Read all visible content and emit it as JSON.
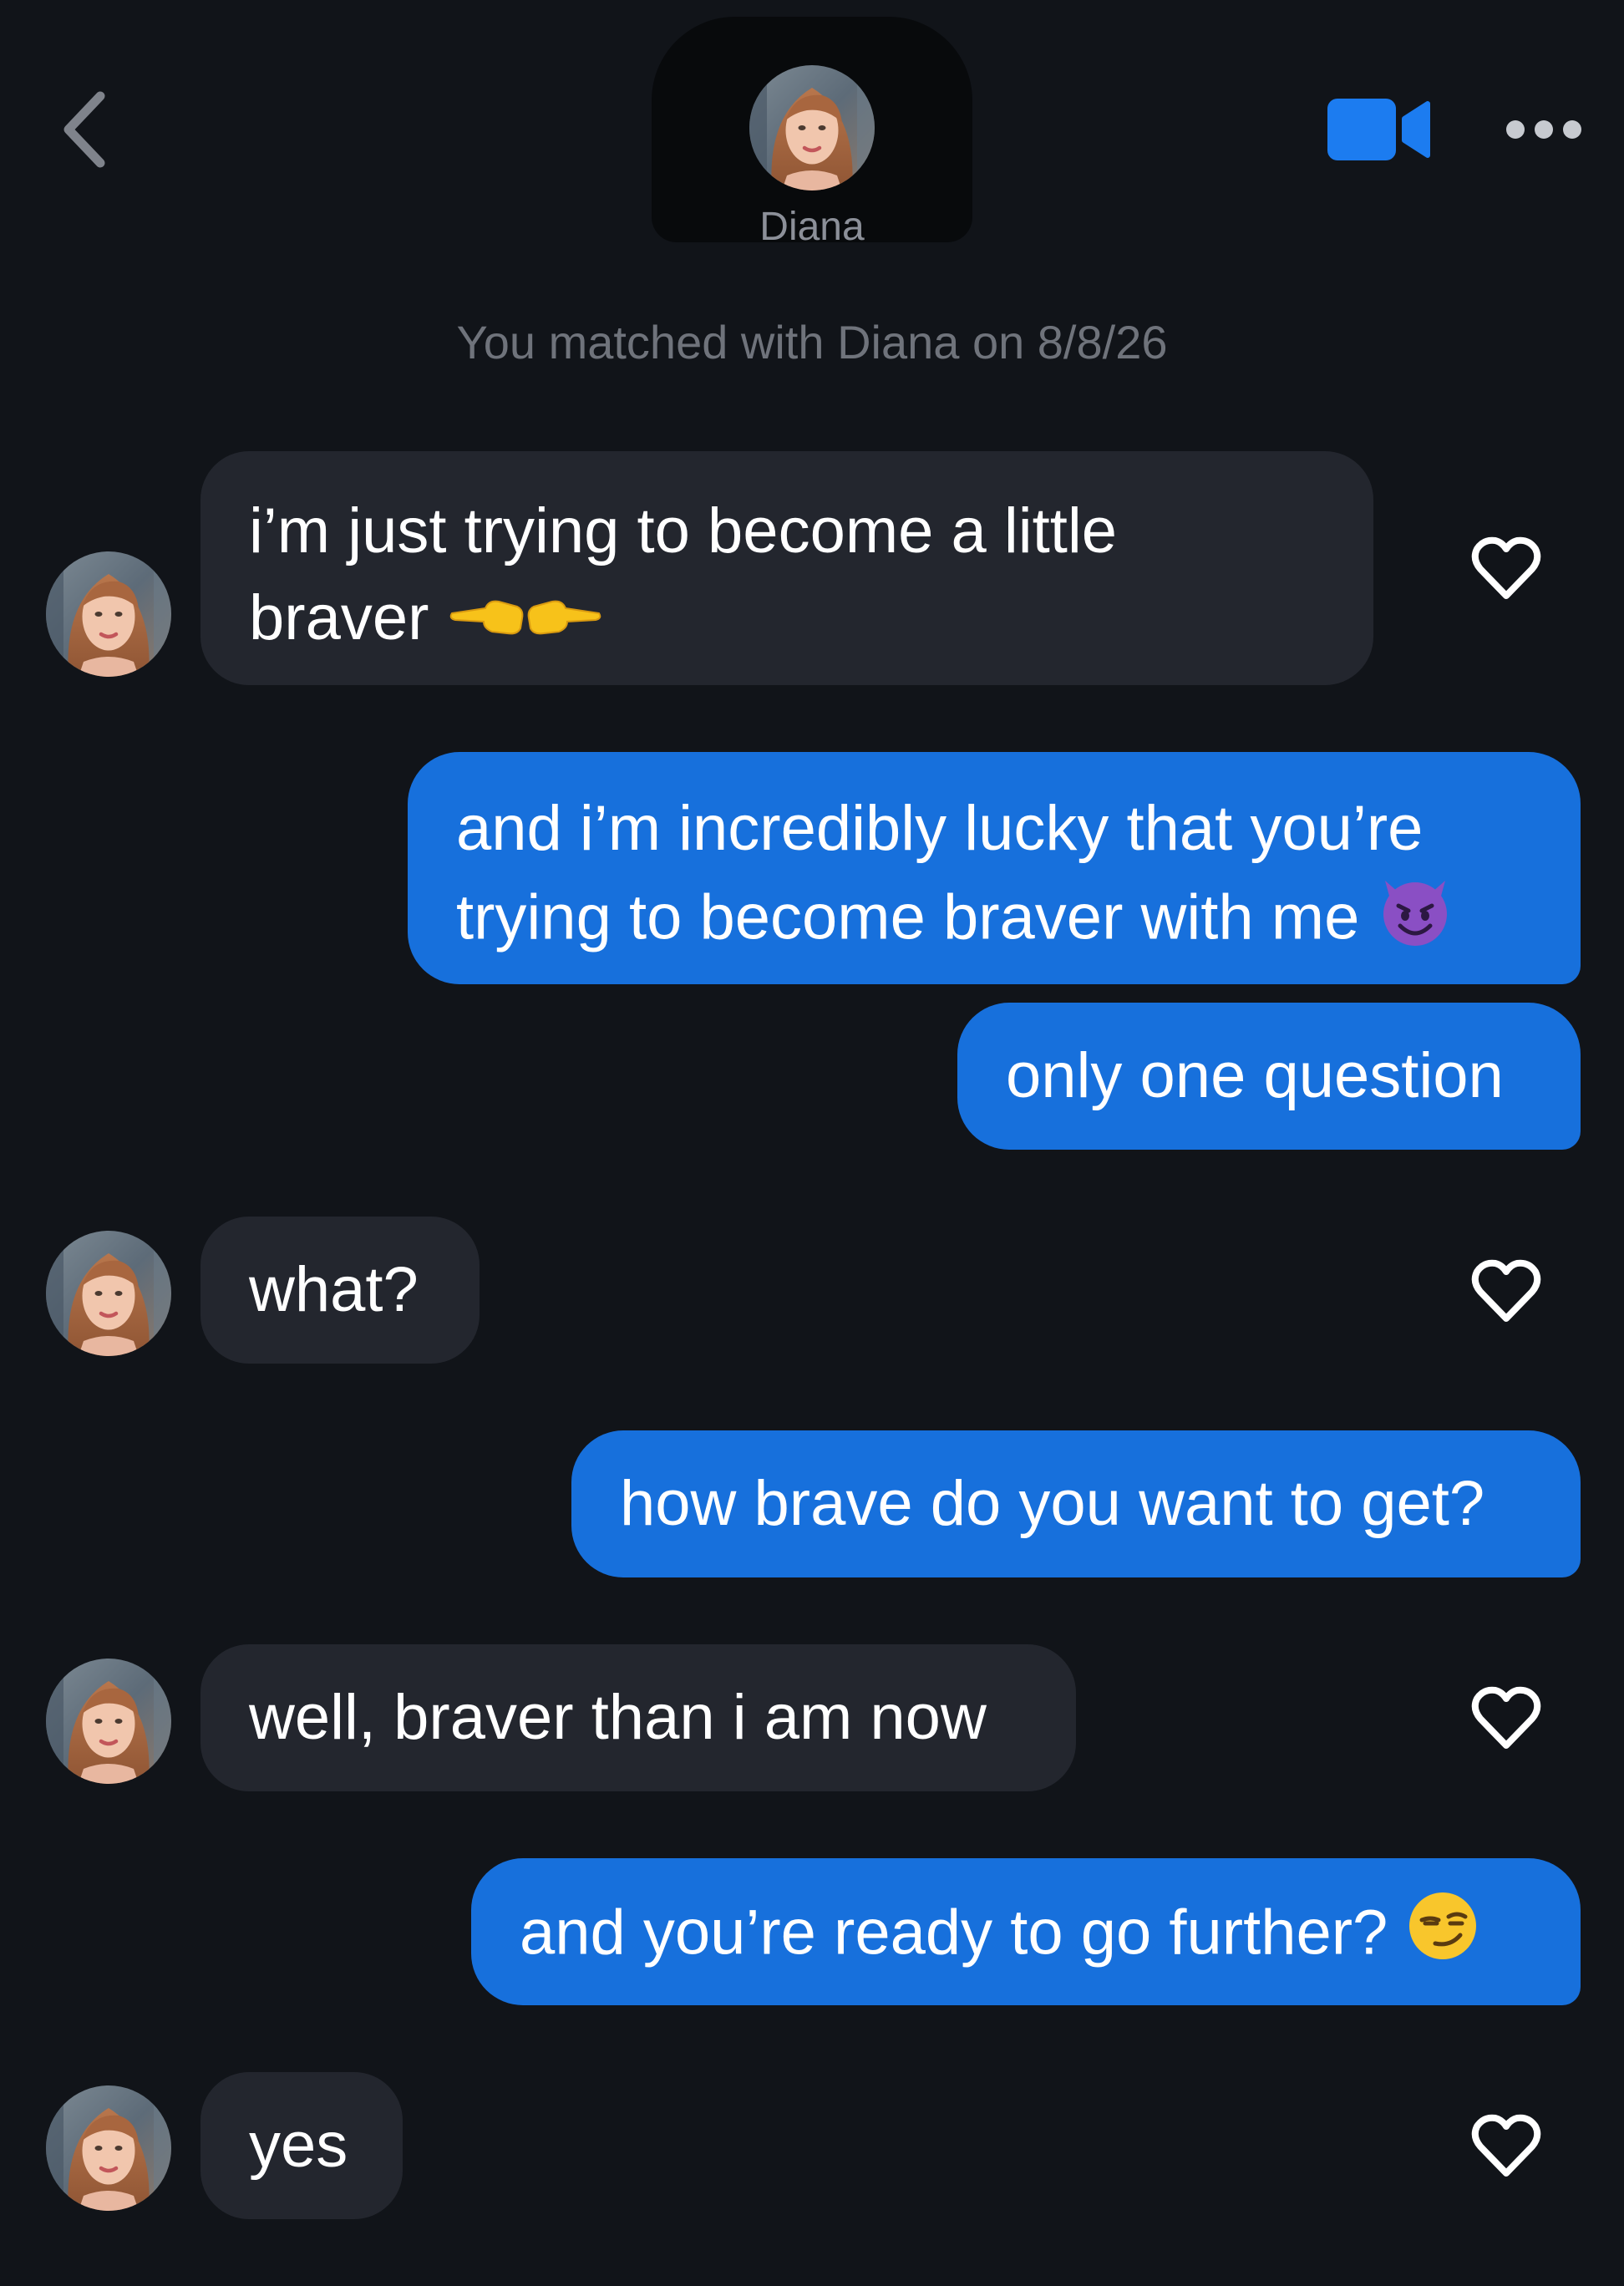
{
  "header": {
    "back_icon": "chevron-left-icon",
    "contact_name": "Diana",
    "video_icon": "video-camera-icon",
    "more_icon": "more-horizontal-icon",
    "accent_color": "#1c7cf0"
  },
  "match_notice": "You matched with Diana on 8/8/26",
  "messages": [
    {
      "sender": "Diana",
      "lines": [
        "i’m just trying to become a little",
        "braver"
      ],
      "emoji": "backhand-index-pointing-left-and-right",
      "liked": false
    },
    {
      "sender": "me",
      "lines": [
        "and i’m incredibly lucky that you’re",
        "trying to become braver with me"
      ],
      "emoji": "smiling-face-with-horns"
    },
    {
      "sender": "me",
      "lines": [
        "only one question"
      ]
    },
    {
      "sender": "Diana",
      "lines": [
        "what?"
      ],
      "liked": false
    },
    {
      "sender": "me",
      "lines": [
        "how brave do you want to get?"
      ]
    },
    {
      "sender": "Diana",
      "lines": [
        "well, braver than i am now"
      ],
      "liked": false
    },
    {
      "sender": "me",
      "lines": [
        "and you’re ready to go further?"
      ],
      "emoji": "smirking-face"
    },
    {
      "sender": "Diana",
      "lines": [
        "yes"
      ],
      "liked": false
    }
  ],
  "colors": {
    "background": "#111419",
    "incoming_bubble": "#23262e",
    "outgoing_bubble": "#1770dc"
  }
}
